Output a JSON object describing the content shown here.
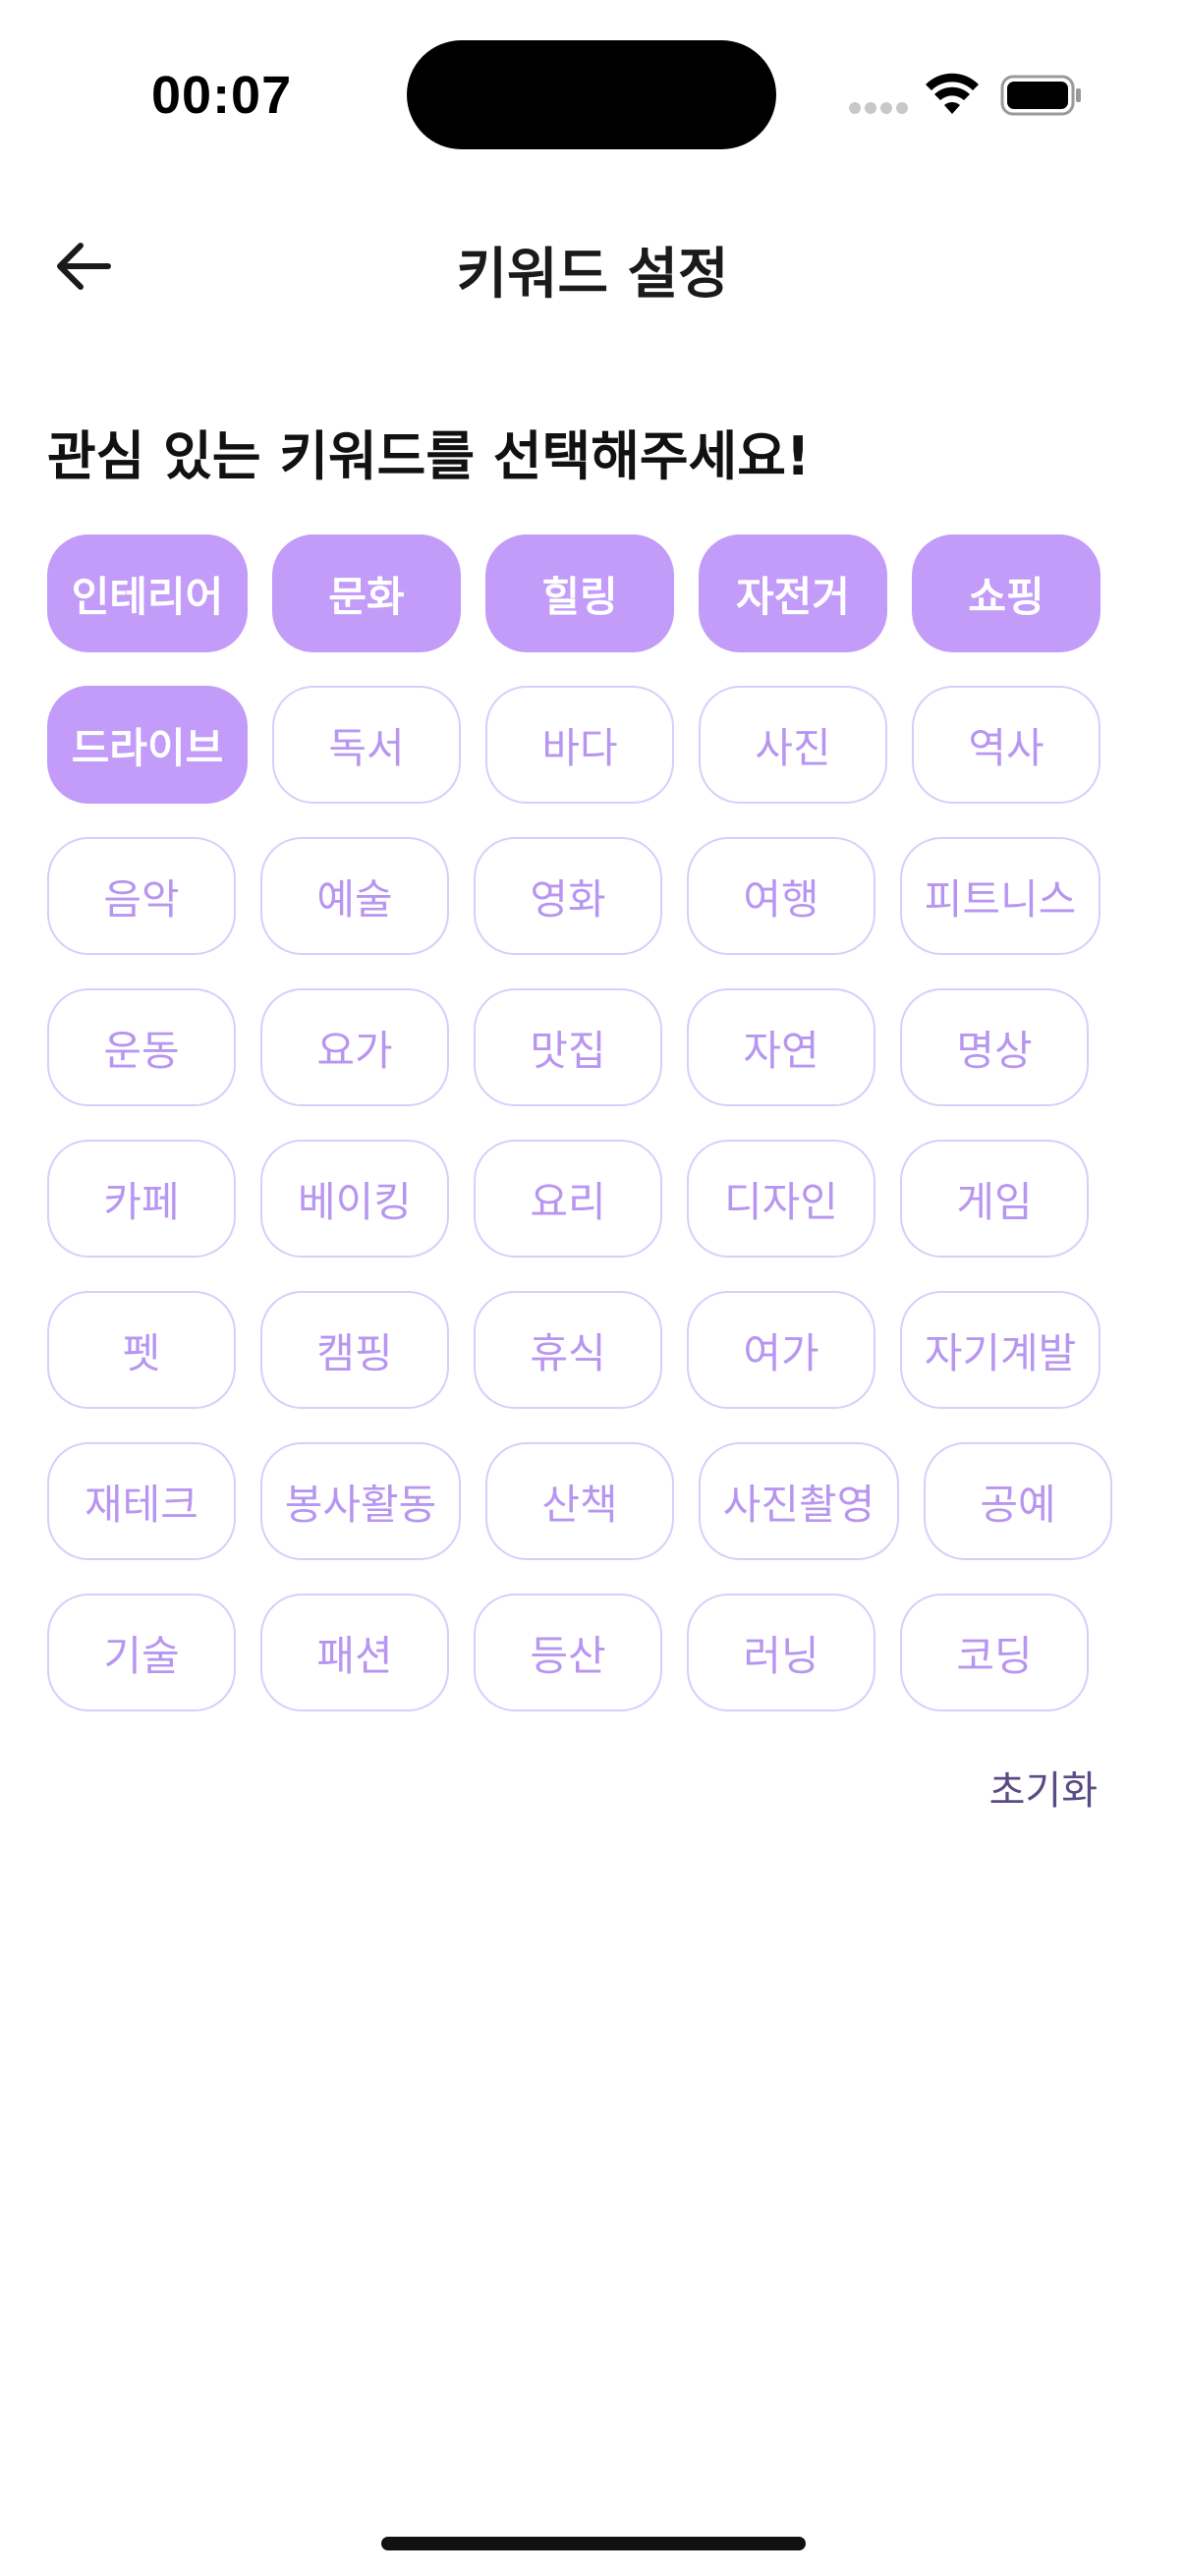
{
  "status_bar": {
    "time": "00:07"
  },
  "header": {
    "title": "키워드 설정"
  },
  "prompt": "관심 있는 키워드를 선택해주세요!",
  "keywords": [
    [
      "인테리어",
      "문화",
      "힐링",
      "자전거",
      "쇼핑"
    ],
    [
      "드라이브",
      "독서",
      "바다",
      "사진",
      "역사"
    ],
    [
      "음악",
      "예술",
      "영화",
      "여행",
      "피트니스"
    ],
    [
      "운동",
      "요가",
      "맛집",
      "자연",
      "명상"
    ],
    [
      "카페",
      "베이킹",
      "요리",
      "디자인",
      "게임"
    ],
    [
      "펫",
      "캠핑",
      "휴식",
      "여가",
      "자기계발"
    ],
    [
      "재테크",
      "봉사활동",
      "산책",
      "사진촬영",
      "공예"
    ],
    [
      "기술",
      "패션",
      "등산",
      "러닝",
      "코딩"
    ]
  ],
  "selected_keywords": [
    "인테리어",
    "문화",
    "힐링",
    "자전거",
    "쇼핑",
    "드라이브"
  ],
  "reset_label": "초기화",
  "colors": {
    "accent": "#c29cf8",
    "chip_text": "#b896f0",
    "chip_border": "#d9cdfb",
    "reset_text": "#5a4a85"
  }
}
